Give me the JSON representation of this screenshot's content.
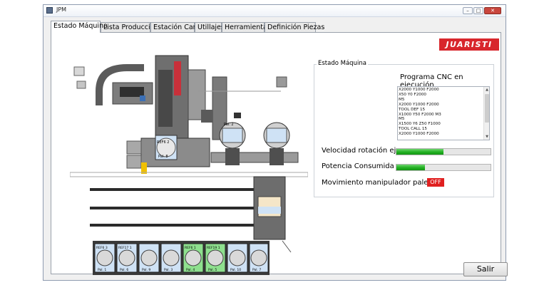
{
  "window": {
    "title": "JPM",
    "controls": {
      "minimize": "–",
      "maximize": "□",
      "close": "✕"
    }
  },
  "tabs": [
    "Estado Máquina",
    "Lista Producción",
    "Estación Carga",
    "Utillajes",
    "Herramientas",
    "Definición Piezas"
  ],
  "logo": "JUARISTI",
  "estado": {
    "group_title": "Estado Máquina",
    "program_title": "Programa CNC en ejecución",
    "program_lines": [
      "X2000 Y1000 F2000",
      "X50 Y0 F2000",
      "M5",
      "X2000 Y1000 F2000",
      "TOOL DEF 15",
      "X1000 Y50 F2000 M3",
      "M5",
      "X1500 Y6 Z50 F1000",
      "TOOL CALL 15",
      "X2000 Y1000 F2000"
    ],
    "scrollbar": {
      "up": "▲",
      "down": "▼"
    },
    "rotation_label": "Velocidad rotación eje",
    "rotation_level": 0.5,
    "power_label": "Potencia Consumida",
    "power_level": 0.3,
    "pallet_label": "Movimiento manipulador palet",
    "pallet_state": "OFF",
    "status_colors": {
      "ok": "#22b022",
      "off": "#e02020"
    }
  },
  "plant": {
    "machine_pallet": {
      "ref": "REF6 2",
      "pal": "Pal. 8"
    },
    "storage": [
      {
        "ref": "Pal. 2"
      },
      {
        "ref": ""
      }
    ],
    "rack": [
      {
        "ref": "REF6 3",
        "pal": "Pal. 1",
        "color": "#cfe2f5"
      },
      {
        "ref": "REF17 1",
        "pal": "Pal. 6",
        "color": "#cfe2f5"
      },
      {
        "ref": "",
        "pal": "Pal. 9",
        "color": "#cfe2f5"
      },
      {
        "ref": "",
        "pal": "Pal. 3",
        "color": "#cfe2f5"
      },
      {
        "ref": "REF6 1",
        "pal": "Pal. 4",
        "color": "#8ee08e"
      },
      {
        "ref": "REF19 1",
        "pal": "Pal. 5",
        "color": "#8ee08e"
      },
      {
        "ref": "",
        "pal": "Pal. 10",
        "color": "#cfe2f5"
      },
      {
        "ref": "",
        "pal": "Pal. 7",
        "color": "#cfe2f5"
      }
    ]
  },
  "footer": {
    "exit_label": "Salir"
  }
}
